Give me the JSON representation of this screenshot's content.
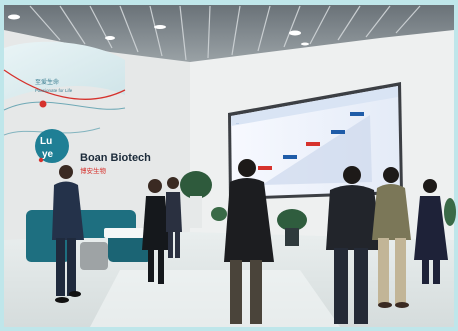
{
  "slogan": {
    "chinese": "至爱生命",
    "english": "Passionate for Life"
  },
  "brand": {
    "logo_line1": "Lu",
    "logo_line2": "ye",
    "name_english": "Boan Biotech",
    "name_chinese": "博安生物"
  },
  "screen": {
    "header_text": "...",
    "labels": [
      "",
      "",
      "",
      "",
      ""
    ]
  },
  "colors": {
    "brand_teal": "#1f7f95",
    "brand_red": "#d6322d",
    "sofa_teal": "#1e6f80",
    "screen_bg": "#eef2fa"
  }
}
